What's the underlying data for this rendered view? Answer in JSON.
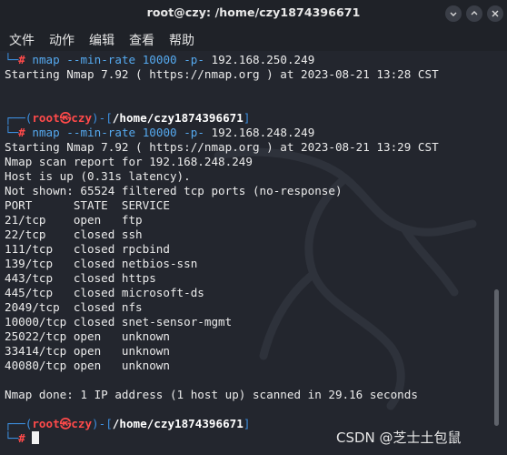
{
  "window": {
    "title": "root@czy: /home/czy1874396671",
    "buttons": [
      "minimize",
      "maximize",
      "close"
    ]
  },
  "menu": [
    "文件",
    "动作",
    "编辑",
    "查看",
    "帮助"
  ],
  "terminal": {
    "block1": {
      "prompt_symbol": "#",
      "command": "nmap",
      "args_opt": "--min-rate 10000 -p-",
      "target": "192.168.250.249",
      "output": "Starting Nmap 7.92 ( https://nmap.org ) at 2023-08-21 13:28 CST"
    },
    "prompt": {
      "user": "root",
      "skull": "㉿",
      "host": "czy",
      "path": "/home/czy1874396671"
    },
    "block2": {
      "prompt_symbol": "#",
      "command": "nmap",
      "args_opt": "--min-rate 10000 -p-",
      "target": "192.168.248.249",
      "output": [
        "Starting Nmap 7.92 ( https://nmap.org ) at 2023-08-21 13:29 CST",
        "Nmap scan report for 192.168.248.249",
        "Host is up (0.31s latency).",
        "Not shown: 65524 filtered tcp ports (no-response)",
        "PORT      STATE  SERVICE",
        "21/tcp    open   ftp",
        "22/tcp    closed ssh",
        "111/tcp   closed rpcbind",
        "139/tcp   closed netbios-ssn",
        "443/tcp   closed https",
        "445/tcp   closed microsoft-ds",
        "2049/tcp  closed nfs",
        "10000/tcp closed snet-sensor-mgmt",
        "25022/tcp open   unknown",
        "33414/tcp open   unknown",
        "40080/tcp open   unknown",
        "",
        "Nmap done: 1 IP address (1 host up) scanned in 29.16 seconds"
      ]
    },
    "block3": {
      "prompt_symbol": "#"
    }
  },
  "watermark": "CSDN @芝士土包鼠",
  "colors": {
    "background": "#23262e",
    "prompt_blue": "#3d8fe0",
    "prompt_red": "#ff4a4a",
    "text": "#ebebeb"
  }
}
